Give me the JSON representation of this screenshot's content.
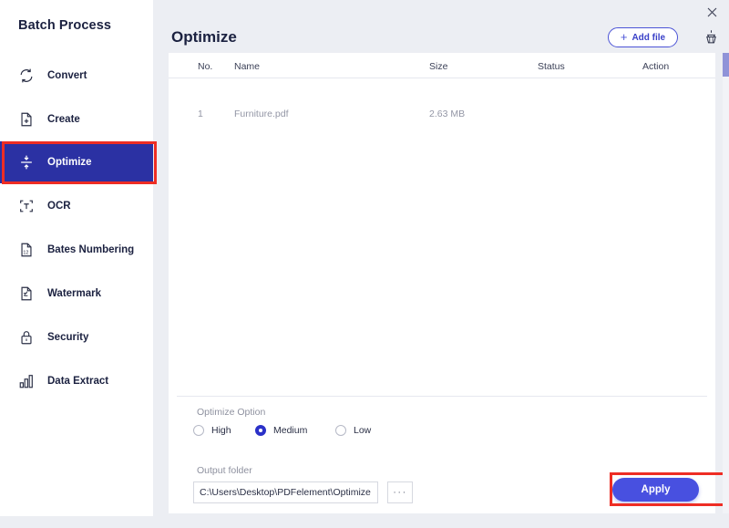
{
  "window": {
    "close_label": "✕"
  },
  "sidebar": {
    "title": "Batch Process",
    "items": [
      {
        "label": "Convert",
        "icon": "convert-icon",
        "active": false
      },
      {
        "label": "Create",
        "icon": "create-icon",
        "active": false
      },
      {
        "label": "Optimize",
        "icon": "optimize-icon",
        "active": true
      },
      {
        "label": "OCR",
        "icon": "ocr-icon",
        "active": false
      },
      {
        "label": "Bates Numbering",
        "icon": "bates-numbering-icon",
        "active": false
      },
      {
        "label": "Watermark",
        "icon": "watermark-icon",
        "active": false
      },
      {
        "label": "Security",
        "icon": "security-lock-icon",
        "active": false
      },
      {
        "label": "Data Extract",
        "icon": "data-extract-icon",
        "active": false
      }
    ],
    "highlight_color": "#ee2d24",
    "active_bg": "#2b31a3"
  },
  "header": {
    "title": "Optimize",
    "add_file_label": "Add file",
    "add_file_plus": "+",
    "clear_icon": "broom-clear-icon"
  },
  "table": {
    "columns": [
      "No.",
      "Name",
      "Size",
      "Status",
      "Action"
    ],
    "rows": [
      {
        "no": "1",
        "name": "Furniture.pdf",
        "size": "2.63 MB",
        "status": "",
        "action": ""
      }
    ]
  },
  "options": {
    "group_label": "Optimize Option",
    "choices": [
      {
        "label": "High",
        "selected": false
      },
      {
        "label": "Medium",
        "selected": true
      },
      {
        "label": "Low",
        "selected": false
      }
    ]
  },
  "output": {
    "label": "Output folder",
    "value": "C:\\Users\\Desktop\\PDFelement\\Optimize",
    "placeholder": "C:\\Users\\Desktop\\PDFelement\\Optimize",
    "browse_label": "···"
  },
  "actions": {
    "apply_label": "Apply",
    "apply_color": "#4850e0",
    "apply_highlight_color": "#ee2d24"
  }
}
